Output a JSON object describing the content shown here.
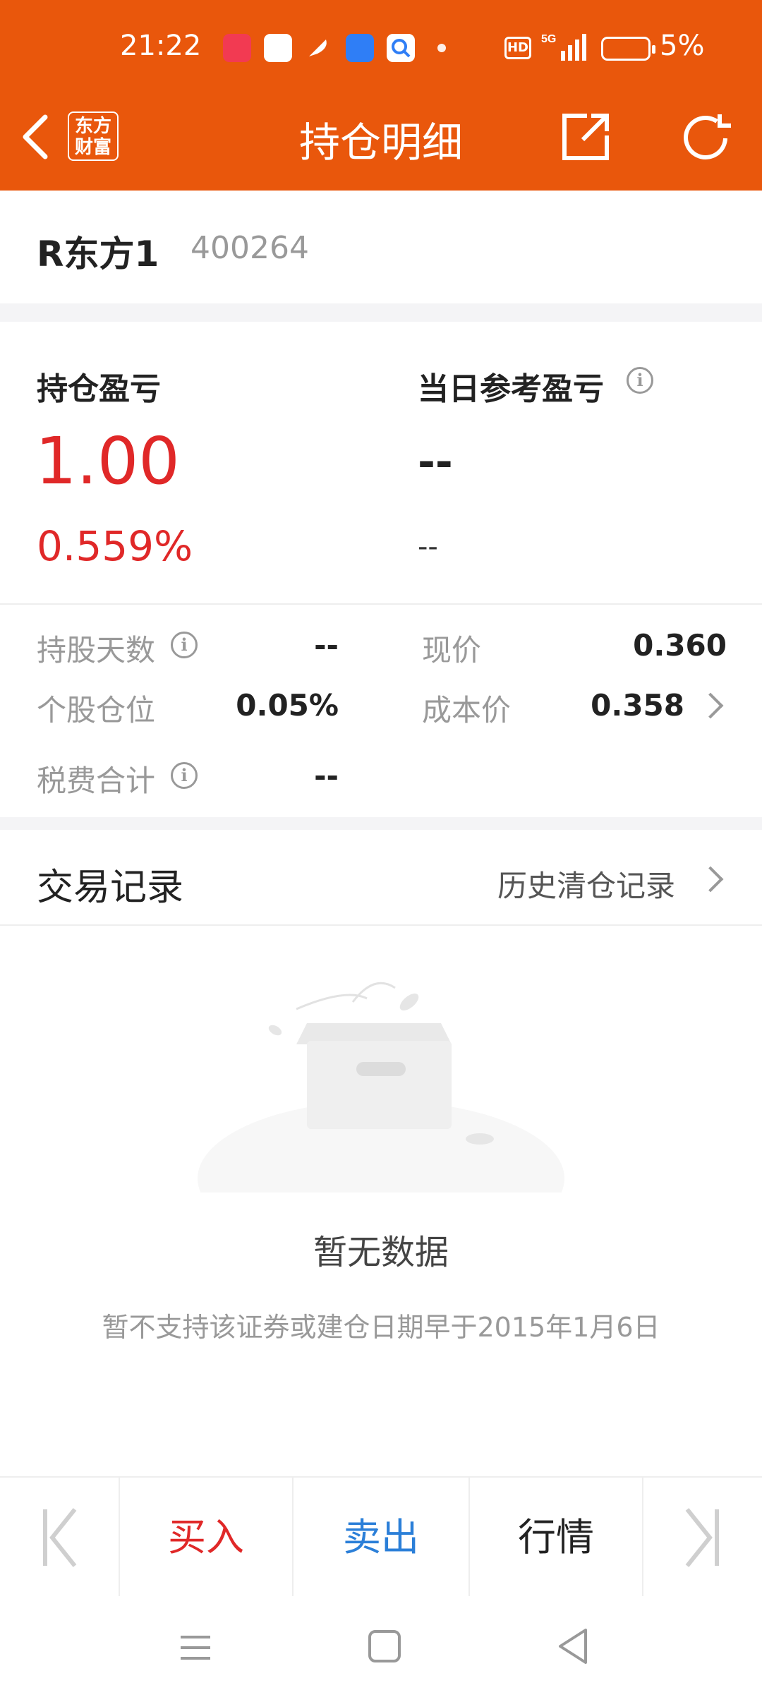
{
  "status_bar": {
    "time": "21:22",
    "network": "5G",
    "badge": "HD",
    "battery": "5%"
  },
  "header": {
    "logo_line1": "东方",
    "logo_line2": "财富",
    "title": "持仓明细",
    "back_icon": "back-arrow-icon",
    "share_icon": "share-icon",
    "refresh_icon": "refresh-icon",
    "color": "#e9570c"
  },
  "stock": {
    "name": "R东方1",
    "code": "400264"
  },
  "pnl": {
    "position_label": "持仓盈亏",
    "position_value": "1.00",
    "position_pct": "0.559%",
    "daily_label": "当日参考盈亏",
    "daily_value": "--",
    "daily_pct": "--",
    "accent": "#e02828"
  },
  "details": {
    "days_label": "持股天数",
    "days_value": "--",
    "price_label": "现价",
    "price_value": "0.360",
    "position_ratio_label": "个股仓位",
    "position_ratio_value": "0.05%",
    "cost_label": "成本价",
    "cost_value": "0.358",
    "fees_label": "税费合计",
    "fees_value": "--"
  },
  "records": {
    "title": "交易记录",
    "history_link": "历史清仓记录",
    "empty_title": "暂无数据",
    "empty_sub": "暂不支持该证券或建仓日期早于2015年1月6日"
  },
  "bottom_bar": {
    "buy": "买入",
    "sell": "卖出",
    "quote": "行情",
    "buy_color": "#e02828",
    "sell_color": "#2b7fd8"
  }
}
